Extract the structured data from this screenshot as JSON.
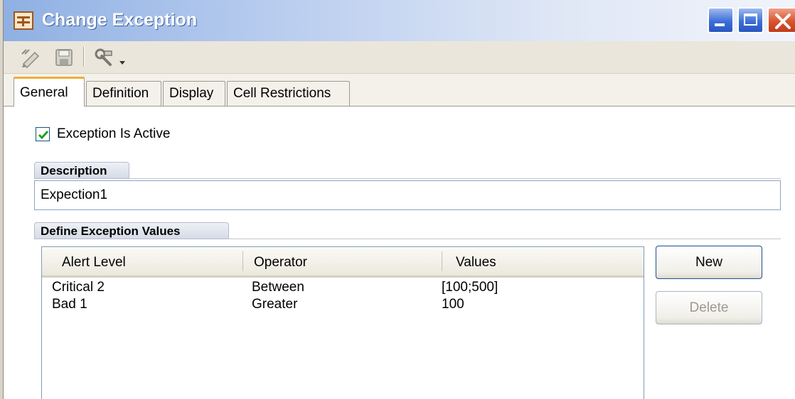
{
  "window": {
    "title": "Change Exception"
  },
  "toolbar": {
    "icons": [
      "pencil-icon",
      "save-icon",
      "tools-icon",
      "dropdown-arrow-icon"
    ]
  },
  "tabs": [
    {
      "label": "General",
      "active": true
    },
    {
      "label": "Definition",
      "active": false
    },
    {
      "label": "Display",
      "active": false
    },
    {
      "label": "Cell Restrictions",
      "active": false
    }
  ],
  "general": {
    "active_checkbox": {
      "label": "Exception Is Active",
      "checked": true
    },
    "description": {
      "header": "Description",
      "value": "Expection1"
    },
    "values": {
      "header": "Define Exception Values",
      "columns": [
        "Alert Level",
        "Operator",
        "Values"
      ],
      "rows": [
        {
          "alert_level": "Critical 2",
          "operator": "Between",
          "values": "[100;500]"
        },
        {
          "alert_level": "Bad 1",
          "operator": "Greater",
          "values": "100"
        }
      ],
      "new_label": "New",
      "delete_label": "Delete"
    }
  },
  "colors": {
    "active_tab_accent": "#f2ad3a",
    "title_gradient_start": "#8fb0e3",
    "checkmark": "#21a121"
  }
}
